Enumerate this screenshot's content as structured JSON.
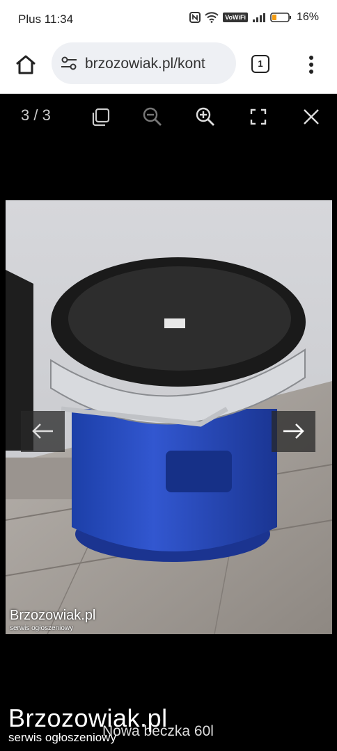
{
  "status_bar": {
    "carrier_time": "Plus 11:34",
    "network": "VoWiFi",
    "battery": "16%"
  },
  "browser": {
    "url": "brzozowiak.pl/kont",
    "tab_count": "1"
  },
  "viewer": {
    "counter": "3 / 3",
    "icons": [
      "copy-icon",
      "zoom-out-icon",
      "zoom-in-icon",
      "fullscreen-icon",
      "close-icon"
    ],
    "photo_watermark": "Brzozowiak.pl",
    "photo_watermark_sub": "serwis ogłoszeniowy",
    "prev_icon": "arrow-left-icon",
    "next_icon": "arrow-right-icon"
  },
  "footer": {
    "watermark": "Brzozowiak.pl",
    "watermark_sub": "serwis ogłoszeniowy",
    "caption": "Nowa beczka 60l"
  }
}
